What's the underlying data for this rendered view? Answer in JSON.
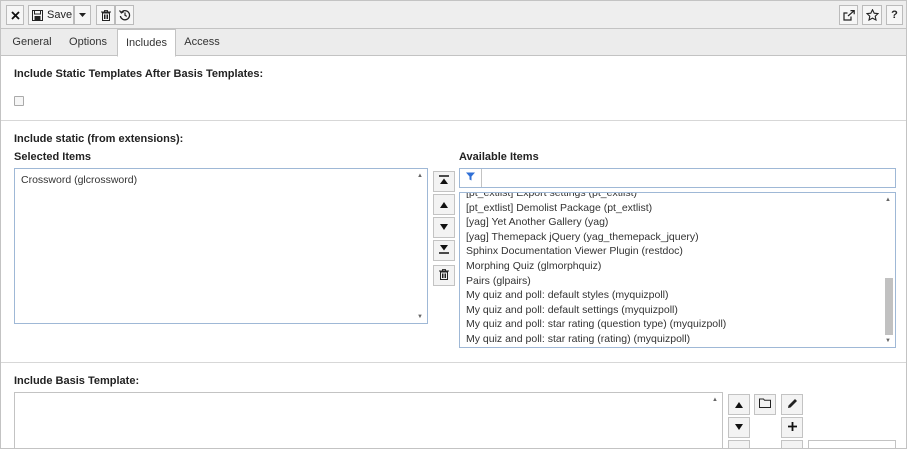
{
  "toolbar": {
    "close_icon": "close-icon",
    "save_label": "Save",
    "save_icon": "save-icon",
    "dropdown_icon": "chevron-down-icon",
    "delete_icon": "trash-icon",
    "history_icon": "history-icon",
    "open_new_icon": "external-link-icon",
    "bookmark_icon": "star-icon",
    "help_label": "?"
  },
  "tabs": [
    {
      "label": "General"
    },
    {
      "label": "Options"
    },
    {
      "label": "Includes",
      "active": true
    },
    {
      "label": "Access"
    }
  ],
  "static_after_basis": {
    "title": "Include Static Templates After Basis Templates:",
    "checked": false
  },
  "include_static": {
    "title": "Include static (from extensions):",
    "selected_label": "Selected Items",
    "selected_items": [
      "Crossword (glcrossword)"
    ],
    "available_label": "Available Items",
    "filter_value": "",
    "available_items": [
      "[pt_extlist] Export settings (pt_extlist)",
      "[pt_extlist] Demolist Package (pt_extlist)",
      "[yag] Yet Another Gallery (yag)",
      "[yag] Themepack jQuery (yag_themepack_jquery)",
      "Sphinx Documentation Viewer Plugin (restdoc)",
      "Morphing Quiz (glmorphquiz)",
      "Pairs (glpairs)",
      "My quiz and poll: default styles (myquizpoll)",
      "My quiz and poll: default settings (myquizpoll)",
      "My quiz and poll: star rating (question type) (myquizpoll)",
      "My quiz and poll: star rating (rating) (myquizpoll)"
    ],
    "available_scroll_fraction": 0.85
  },
  "include_basis": {
    "title": "Include Basis Template:"
  },
  "colors": {
    "toolbar_bg": "#eeeeee",
    "border": "#c3c3c3",
    "focus_border": "#9fb8d6",
    "filter_icon": "#2f6fd6"
  }
}
